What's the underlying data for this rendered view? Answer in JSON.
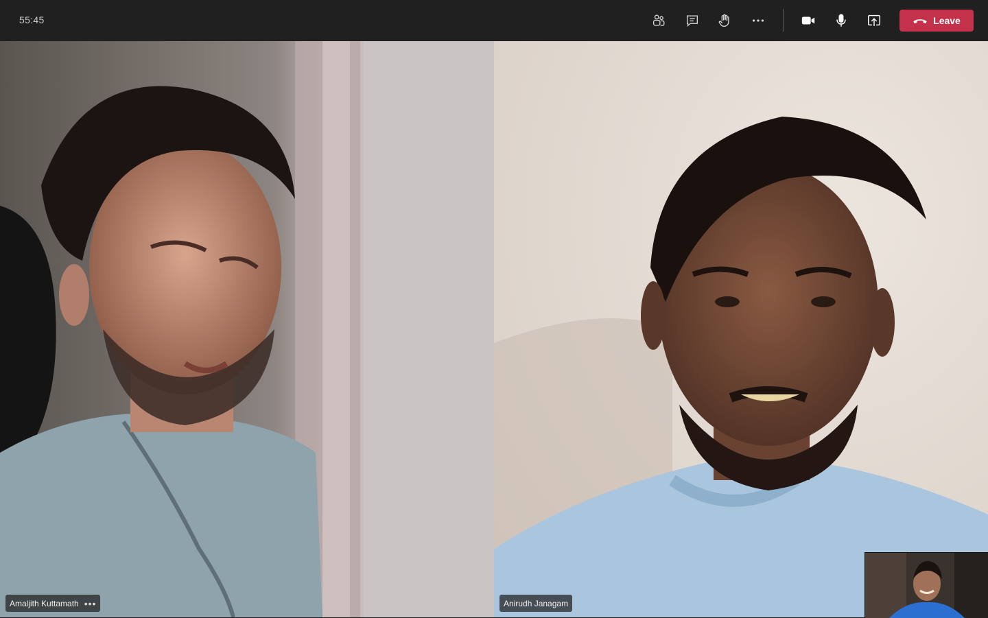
{
  "call": {
    "timer": "55:45",
    "leave_label": "Leave"
  },
  "toolbar": {
    "buttons": [
      {
        "name": "participants",
        "icon": "people-icon"
      },
      {
        "name": "chat",
        "icon": "chat-icon"
      },
      {
        "name": "raise-hand",
        "icon": "hand-icon"
      },
      {
        "name": "more-actions",
        "icon": "ellipsis-icon"
      },
      {
        "name": "camera",
        "icon": "video-camera-icon"
      },
      {
        "name": "microphone",
        "icon": "microphone-icon"
      },
      {
        "name": "share",
        "icon": "share-screen-icon"
      }
    ],
    "leave_color": "#c4314b"
  },
  "participants": [
    {
      "name": "Amaljith Kuttamath",
      "more": "•••"
    },
    {
      "name": "Anirudh Janagam"
    }
  ],
  "colors": {
    "topbar": "#202020",
    "accent_leave": "#c4314b"
  }
}
